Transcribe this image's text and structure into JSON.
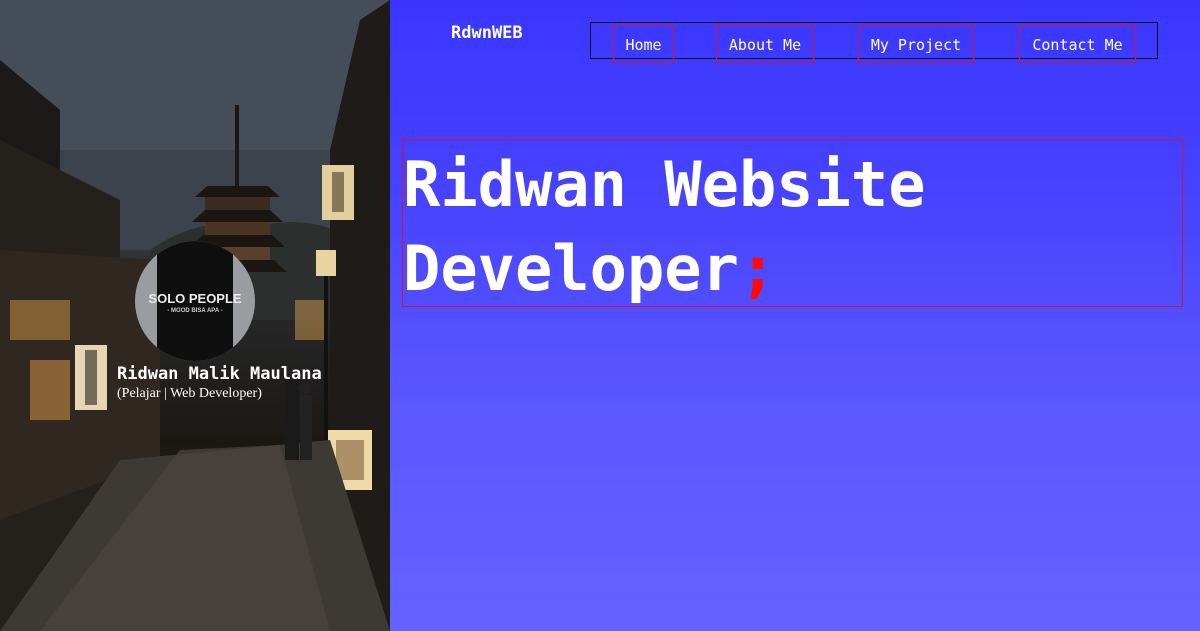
{
  "brand": "RdwnWEB",
  "nav": {
    "items": [
      {
        "label": "Home"
      },
      {
        "label": "About Me"
      },
      {
        "label": "My Project"
      },
      {
        "label": "Contact Me"
      }
    ]
  },
  "hero": {
    "line1": "Ridwan Website",
    "line2": "Developer",
    "accent": ";"
  },
  "profile": {
    "name": "Ridwan Malik Maulana",
    "role": "(Pelajar | Web Developer)",
    "avatar_shirt_text": "SOLO PEOPLE",
    "avatar_shirt_subtext": "- MOOD BISA APA -"
  },
  "colors": {
    "accent": "#ff0a0a",
    "nav_outline": "#d4143a",
    "panel_top": "#3a36ff",
    "panel_bottom": "#6462fd"
  }
}
